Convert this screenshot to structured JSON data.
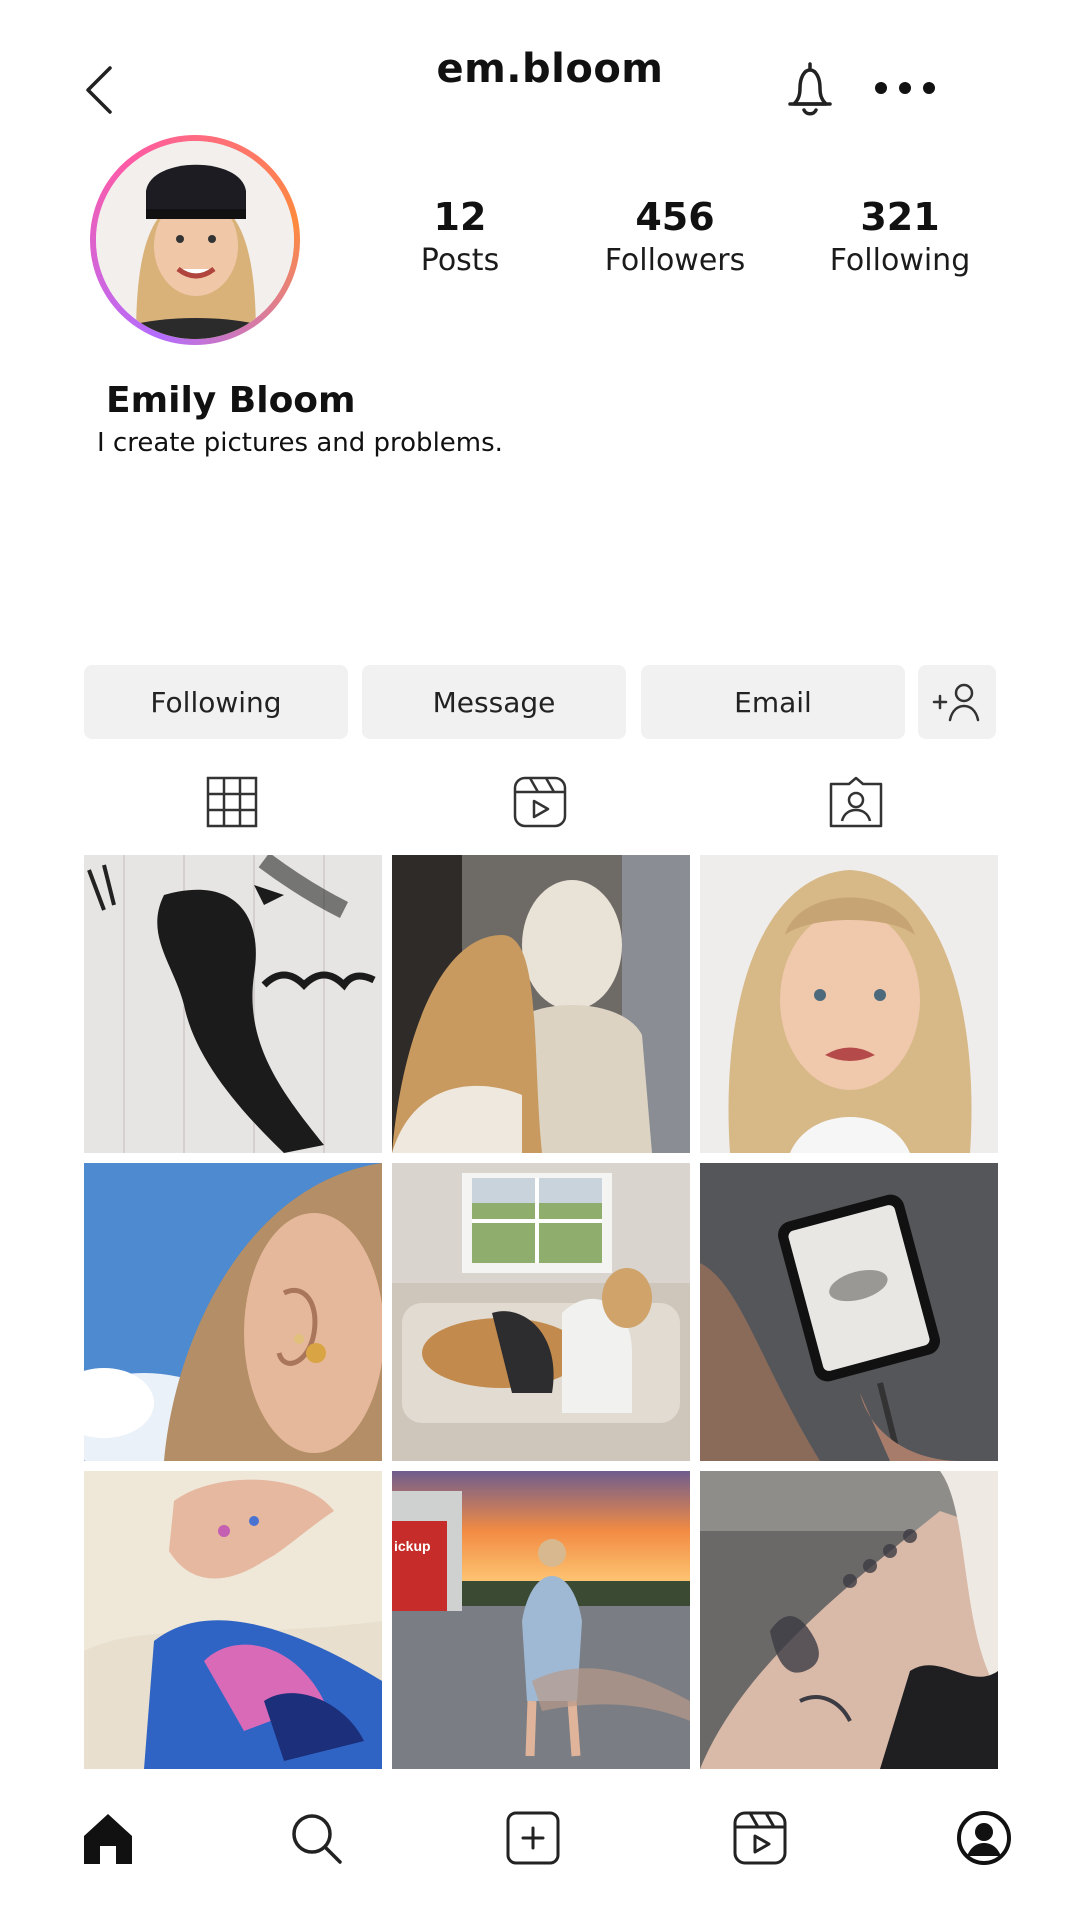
{
  "header": {
    "username": "em.bloom"
  },
  "profile": {
    "posts": {
      "count": "12",
      "label": "Posts"
    },
    "followers": {
      "count": "456",
      "label": "Followers"
    },
    "following": {
      "count": "321",
      "label": "Following"
    },
    "name": "Emily Bloom",
    "bio": "I create pictures and problems."
  },
  "actions": {
    "following": "Following",
    "message": "Message",
    "email": "Email"
  },
  "tabs": [
    "grid-icon",
    "reels-icon",
    "tagged-icon"
  ],
  "grid": {
    "photos": [
      "crow sketch",
      "girl with statue",
      "girl face",
      "ear piercings",
      "couch with dog",
      "tablet drawing",
      "paint hands",
      "sunset parking",
      "arm tattoo"
    ],
    "pickup_sign": "ickup"
  },
  "bottom_nav": [
    "home-icon",
    "search-icon",
    "add-post-icon",
    "reels-icon",
    "profile-icon"
  ],
  "colors": {
    "accent": "#b36cff",
    "button_bg": "#f1f1f2"
  }
}
